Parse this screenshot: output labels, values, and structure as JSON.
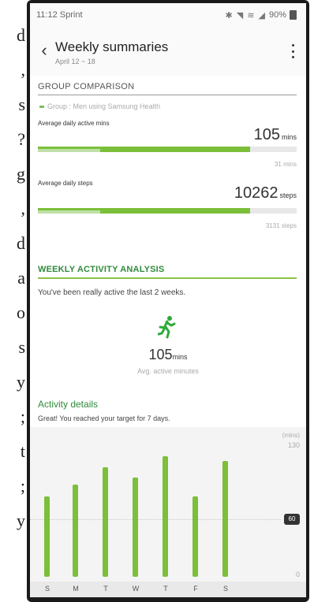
{
  "side_text": [
    "d",
    ",",
    "s",
    "?",
    "g",
    ",",
    "d",
    "a",
    "o",
    "s",
    "y",
    ";",
    "t",
    ";",
    "y"
  ],
  "status": {
    "time": "11:12 Sprint",
    "battery": "90%"
  },
  "header": {
    "title": "Weekly summaries",
    "subtitle": "April 12 ~ 18"
  },
  "group": {
    "title": "GROUP COMPARISON",
    "legend": "Group : Men using Samsung Health",
    "metrics": [
      {
        "label": "Average daily active mins",
        "value": "105",
        "unit": "mins",
        "group_value": "31 mins",
        "fill": 0.82,
        "group_fill": 0.24
      },
      {
        "label": "Average daily steps",
        "value": "10262",
        "unit": "steps",
        "group_value": "3131 steps",
        "fill": 0.82,
        "group_fill": 0.24
      }
    ]
  },
  "weekly": {
    "title": "WEEKLY ACTIVITY ANALYSIS",
    "message": "You've been really active the last 2 weeks.",
    "value": "105",
    "unit": "mins",
    "caption": "Avg. active minutes"
  },
  "details": {
    "title": "Activity details",
    "message": "Great! You reached your target for 7 days."
  },
  "chart_data": {
    "type": "bar",
    "categories": [
      "S",
      "M",
      "T",
      "W",
      "T",
      "F",
      "S"
    ],
    "values": [
      84,
      96,
      114,
      104,
      126,
      84,
      121
    ],
    "ylim": [
      0,
      130
    ],
    "ylabel": "(mins)",
    "y_ticks": [
      "130",
      "0"
    ],
    "target": 60,
    "target_label": "60"
  },
  "colors": {
    "accent": "#7cbf3a",
    "title_green": "#2e8b3a"
  }
}
